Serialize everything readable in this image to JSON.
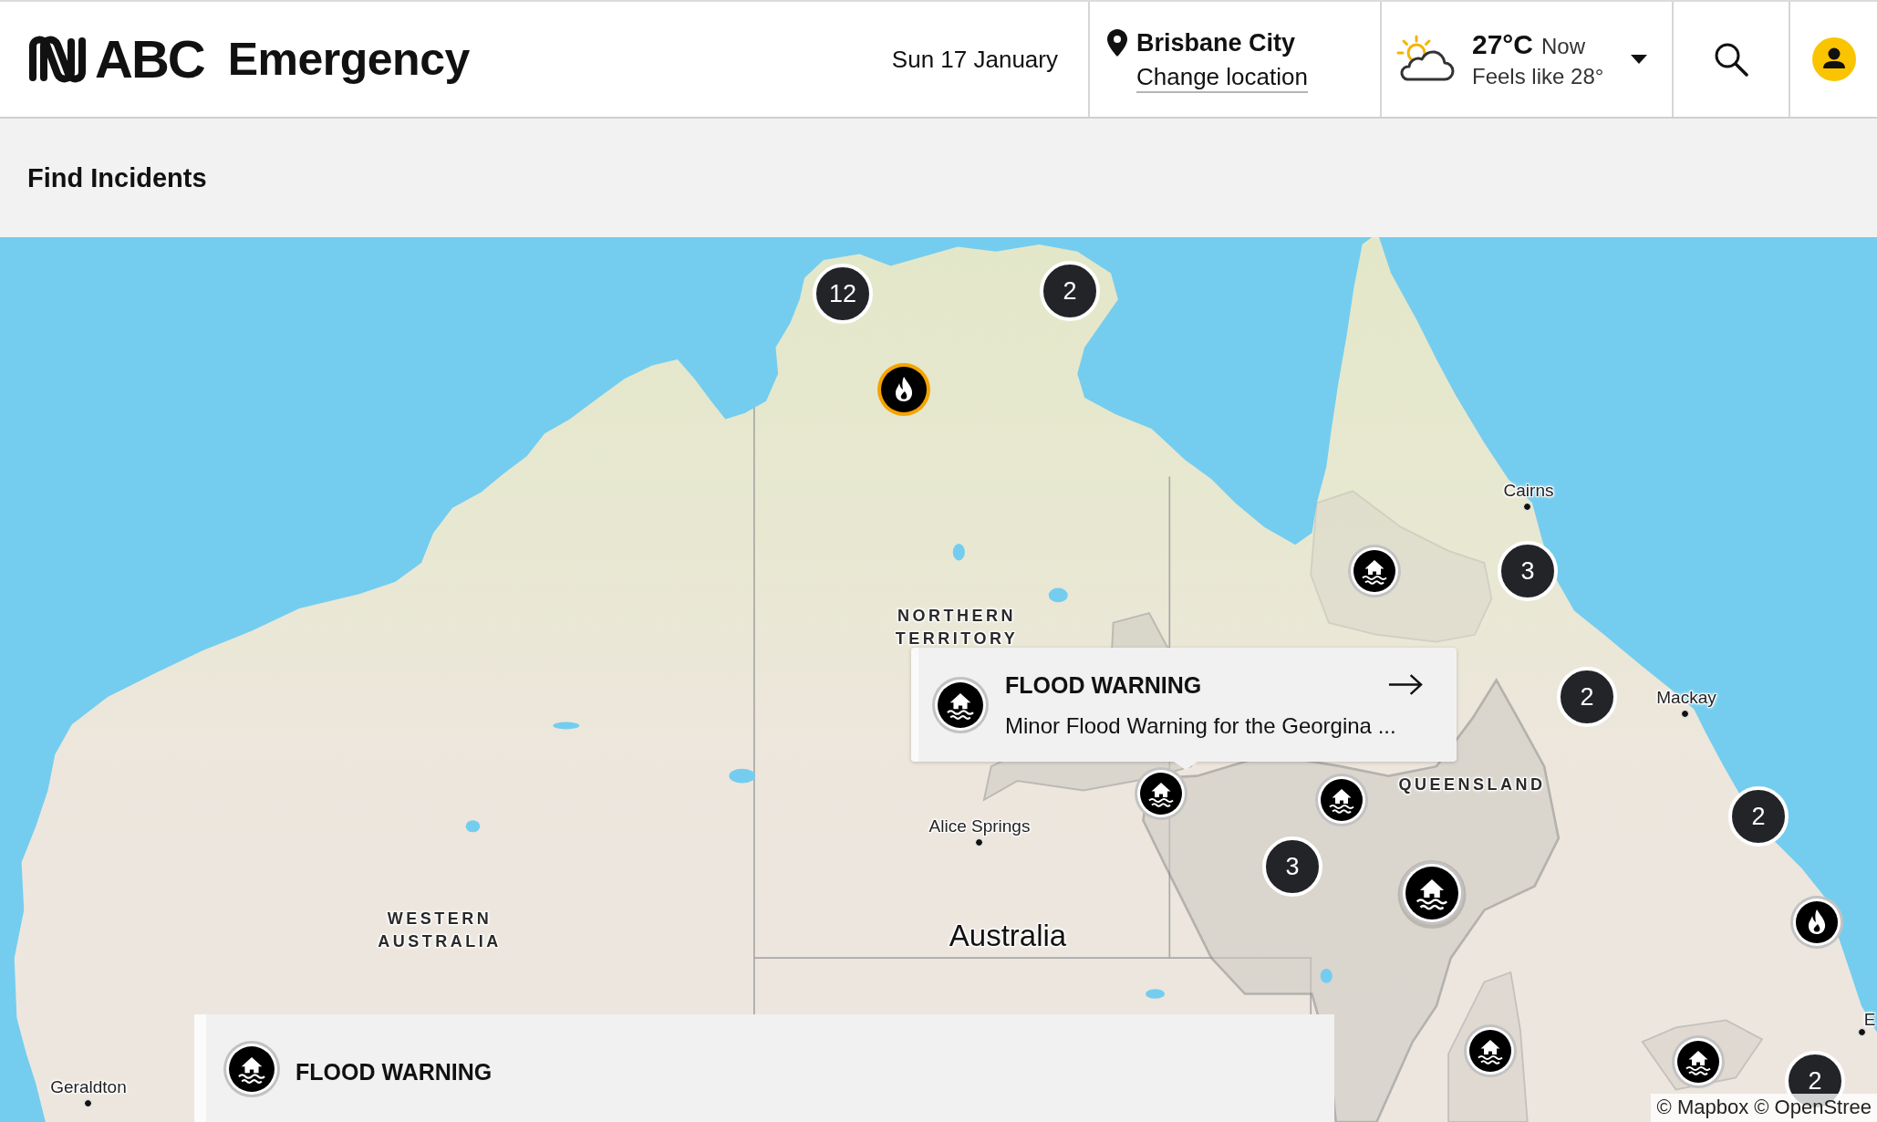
{
  "header": {
    "logo_text": "ABC",
    "title": "Emergency",
    "date": "Sun 17 January",
    "location": {
      "name": "Brisbane City",
      "link": "Change location"
    },
    "weather": {
      "temperature": "27°C",
      "period": "Now",
      "feels_like": "Feels like 28°"
    }
  },
  "page_title": "Find Incidents",
  "map": {
    "place_labels": [
      {
        "kind": "town",
        "text": "Cairns"
      },
      {
        "kind": "region",
        "text": "NORTHERN TERRITORY"
      },
      {
        "kind": "town",
        "text": "Mackay"
      },
      {
        "kind": "region",
        "text": "QUEENSLAND"
      },
      {
        "kind": "town",
        "text": "Alice Springs"
      },
      {
        "kind": "region",
        "text": "WESTERN AUSTRALIA"
      },
      {
        "kind": "country",
        "text": "Australia"
      },
      {
        "kind": "town",
        "text": "E"
      },
      {
        "kind": "town",
        "text": "Geraldton"
      }
    ],
    "markers": [
      {
        "kind": "cluster",
        "count": "12",
        "selected": false,
        "hovered": false
      },
      {
        "kind": "cluster",
        "count": "2",
        "selected": false,
        "hovered": false
      },
      {
        "kind": "fire",
        "selected": true,
        "hovered": false
      },
      {
        "kind": "flood",
        "selected": false,
        "hovered": false
      },
      {
        "kind": "cluster",
        "count": "3",
        "selected": false,
        "hovered": false
      },
      {
        "kind": "cluster",
        "count": "2",
        "selected": false,
        "hovered": false
      },
      {
        "kind": "flood",
        "selected": false,
        "hovered": false
      },
      {
        "kind": "flood",
        "selected": false,
        "hovered": false
      },
      {
        "kind": "cluster",
        "count": "2",
        "selected": false,
        "hovered": false
      },
      {
        "kind": "cluster",
        "count": "3",
        "selected": false,
        "hovered": false
      },
      {
        "kind": "flood",
        "selected": false,
        "hovered": true
      },
      {
        "kind": "fire",
        "selected": false,
        "hovered": false
      },
      {
        "kind": "flood",
        "selected": false,
        "hovered": false
      },
      {
        "kind": "flood",
        "selected": false,
        "hovered": false
      },
      {
        "kind": "cluster",
        "count": "2",
        "selected": false,
        "hovered": false
      }
    ],
    "popup": {
      "kind": "flood",
      "title": "FLOOD WARNING",
      "description": "Minor Flood Warning for the Georgina ..."
    },
    "attribution": "© Mapbox © OpenStree"
  },
  "incident_panel": {
    "kind": "flood",
    "title": "FLOOD WARNING"
  }
}
